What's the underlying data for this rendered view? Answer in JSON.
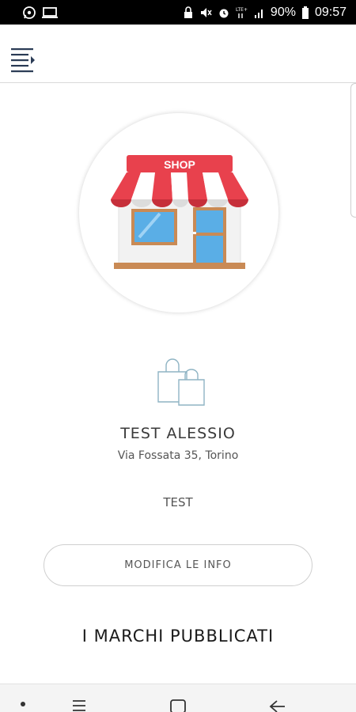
{
  "status_bar": {
    "battery": "90%",
    "time": "09:57",
    "icons": [
      "whatsapp-icon",
      "screen-icon",
      "lock-icon",
      "mute-icon",
      "alarm-icon",
      "lte-signal-icon",
      "signal-bars-icon",
      "battery-icon"
    ]
  },
  "header": {
    "menu_icon": "menu-list-icon"
  },
  "shop": {
    "image_label": "SHOP",
    "name": "TEST ALESSIO",
    "address": "Via Fossata 35, Torino",
    "description": "TEST"
  },
  "actions": {
    "edit_label": "MODIFICA LE INFO"
  },
  "sections": {
    "brands_title": "I MARCHI PUBBLICATI"
  },
  "nav_bar": {
    "icons": [
      "dot-icon",
      "recent-apps-icon",
      "home-icon",
      "back-icon"
    ]
  },
  "colors": {
    "accent": "#e8414d",
    "window_blue": "#5aaee6",
    "frame_brown": "#c98a55"
  }
}
